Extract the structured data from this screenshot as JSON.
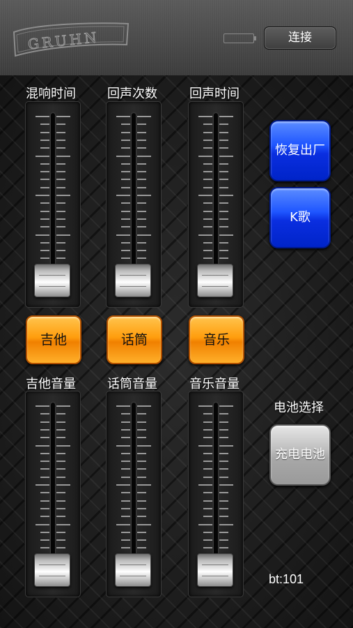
{
  "header": {
    "logo_text": "GRUHN",
    "connect_label": "连接"
  },
  "sliders_top": [
    {
      "label": "混响时间",
      "level": 0
    },
    {
      "label": "回声次数",
      "level": 0
    },
    {
      "label": "回声时间",
      "level": 0
    }
  ],
  "source_buttons": [
    {
      "label": "吉他"
    },
    {
      "label": "话筒"
    },
    {
      "label": "音乐"
    }
  ],
  "sliders_bottom": [
    {
      "label": "吉他音量",
      "level": 0
    },
    {
      "label": "话筒音量",
      "level": 0
    },
    {
      "label": "音乐音量",
      "level": 0
    }
  ],
  "right_panel": {
    "reset_label": "恢复出厂",
    "karaoke_label": "K歌",
    "battery_section_label": "电池选择",
    "battery_button_label": "充电电池",
    "bt_status": "bt:101"
  },
  "colors": {
    "orange_button": "#ff9d0d",
    "blue_button": "#1f56ff",
    "gray_button": "#bfbfbf"
  }
}
